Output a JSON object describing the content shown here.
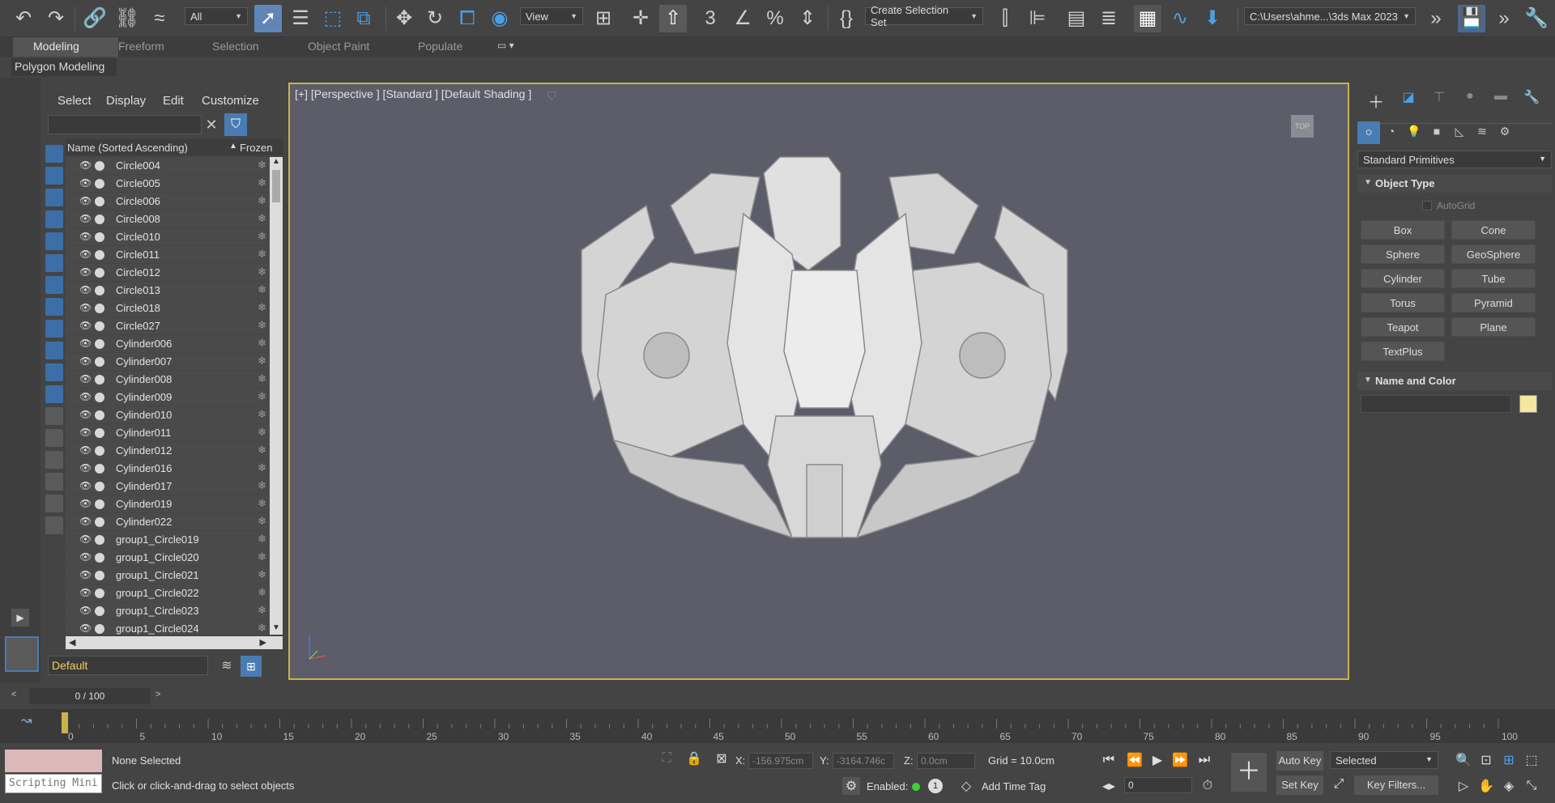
{
  "toolbar": {
    "selection_filter": "All",
    "view_dropdown": "View",
    "selection_set_dropdown": "Create Selection Set",
    "path_dropdown": "C:\\Users\\ahme...\\3ds Max 2023"
  },
  "ribbon_tabs": {
    "items": [
      "Modeling",
      "Freeform",
      "Selection",
      "Object Paint",
      "Populate"
    ],
    "active": "Modeling",
    "subribbon": "Polygon Modeling"
  },
  "scene_explorer": {
    "menu": [
      "Select",
      "Display",
      "Edit",
      "Customize"
    ],
    "search_value": "",
    "col_name": "Name (Sorted Ascending)",
    "col_sort_indicator": "▲",
    "col_frozen": "Frozen",
    "rows": [
      "Circle004",
      "Circle005",
      "Circle006",
      "Circle008",
      "Circle010",
      "Circle011",
      "Circle012",
      "Circle013",
      "Circle018",
      "Circle027",
      "Cylinder006",
      "Cylinder007",
      "Cylinder008",
      "Cylinder009",
      "Cylinder010",
      "Cylinder011",
      "Cylinder012",
      "Cylinder016",
      "Cylinder017",
      "Cylinder019",
      "Cylinder022",
      "group1_Circle019",
      "group1_Circle020",
      "group1_Circle021",
      "group1_Circle022",
      "group1_Circle023",
      "group1_Circle024"
    ],
    "layer": "Default"
  },
  "viewport": {
    "label": "[+] [Perspective ] [Standard ] [Default Shading ]",
    "corner_label": "TOP"
  },
  "command_panel": {
    "category_dropdown": "Standard Primitives",
    "rollout_object_type": "Object Type",
    "autogrid": "AutoGrid",
    "primitives": [
      "Box",
      "Cone",
      "Sphere",
      "GeoSphere",
      "Cylinder",
      "Tube",
      "Torus",
      "Pyramid",
      "Teapot",
      "Plane",
      "TextPlus"
    ],
    "rollout_name_color": "Name and Color",
    "object_color": "#f5e6a0"
  },
  "timeline": {
    "frame_display": "0 / 100",
    "ticks": [
      "0",
      "5",
      "10",
      "15",
      "20",
      "25",
      "30",
      "35",
      "40",
      "45",
      "50",
      "55",
      "60",
      "65",
      "70",
      "75",
      "80",
      "85",
      "90",
      "95",
      "100"
    ]
  },
  "status": {
    "maxscript_label": "Scripting Mini",
    "selection_status": "None Selected",
    "prompt": "Click or click-and-drag to select objects",
    "x_label": "X:",
    "x_value": "-156.975cm",
    "y_label": "Y:",
    "y_value": "-3164.746c",
    "z_label": "Z:",
    "z_value": "0.0cm",
    "grid": "Grid = 10.0cm",
    "enabled_label": "Enabled:",
    "enabled_badge": "1",
    "add_time_tag": "Add Time Tag",
    "auto_key": "Auto Key",
    "set_key": "Set Key",
    "key_mode": "Selected",
    "frame_field": "0",
    "key_filters": "Key Filters..."
  }
}
